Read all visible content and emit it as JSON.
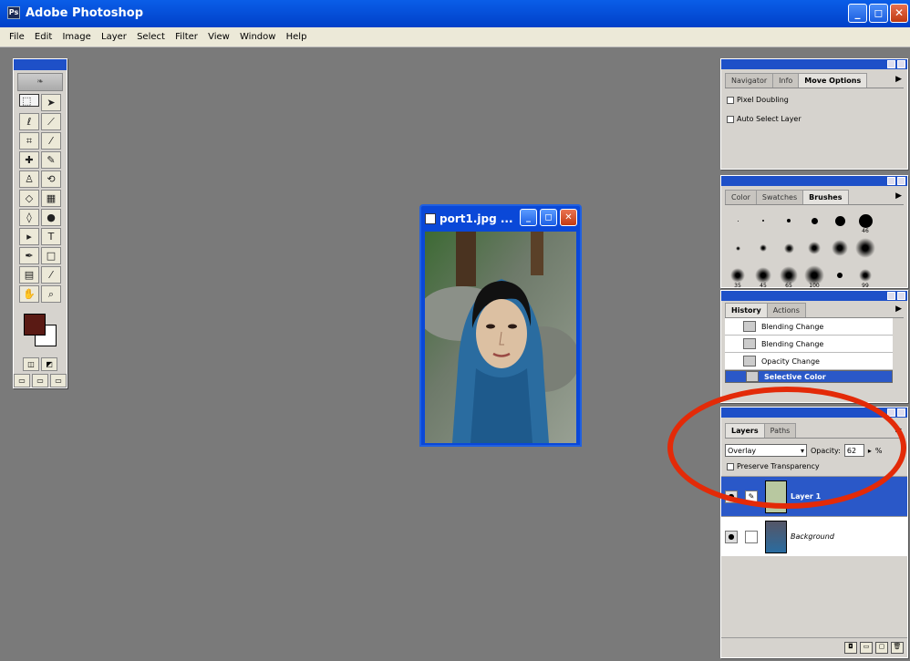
{
  "window": {
    "title": "Adobe Photoshop"
  },
  "menu": [
    "File",
    "Edit",
    "Image",
    "Layer",
    "Select",
    "Filter",
    "View",
    "Window",
    "Help"
  ],
  "toolbox": {
    "tools": [
      "marquee-tool",
      "move-tool",
      "lasso-tool",
      "magic-wand-tool",
      "crop-tool",
      "slice-tool",
      "healing-brush-tool",
      "brush-tool",
      "clone-stamp-tool",
      "history-brush-tool",
      "eraser-tool",
      "gradient-tool",
      "blur-tool",
      "dodge-tool",
      "path-selection-tool",
      "type-tool",
      "pen-tool",
      "shape-tool",
      "notes-tool",
      "eyedropper-tool",
      "hand-tool",
      "zoom-tool"
    ],
    "foreground_color": "#5a1a14",
    "background_color": "#ffffff"
  },
  "document": {
    "title": "port1.jpg ..."
  },
  "navigator_palette": {
    "tabs": [
      "Navigator",
      "Info",
      "Move Options"
    ],
    "active_tab": "Move Options",
    "options": [
      "Pixel Doubling",
      "Auto Select Layer"
    ]
  },
  "brushes_palette": {
    "tabs": [
      "Color",
      "Swatches",
      "Brushes"
    ],
    "active_tab": "Brushes",
    "labels": [
      "46",
      "35",
      "45",
      "65",
      "100",
      "99"
    ]
  },
  "history_palette": {
    "tabs": [
      "History",
      "Actions"
    ],
    "active_tab": "History",
    "items": [
      "Blending Change",
      "Blending Change",
      "Opacity Change",
      "Selective Color"
    ],
    "selected": "Selective Color"
  },
  "layers_palette": {
    "tabs": [
      "Layers",
      "Paths"
    ],
    "active_tab": "Layers",
    "blend_mode": "Overlay",
    "opacity_label": "Opacity:",
    "opacity_value": "62",
    "opacity_unit": "%",
    "preserve_label": "Preserve Transparency",
    "layers": [
      {
        "name": "Layer 1",
        "active": true
      },
      {
        "name": "Background",
        "active": false
      }
    ]
  },
  "colors": {
    "accent": "#0a5ee8",
    "highlight_circle": "#e32a08",
    "selection": "#2a58c8",
    "workspace": "#7a7a7a"
  }
}
